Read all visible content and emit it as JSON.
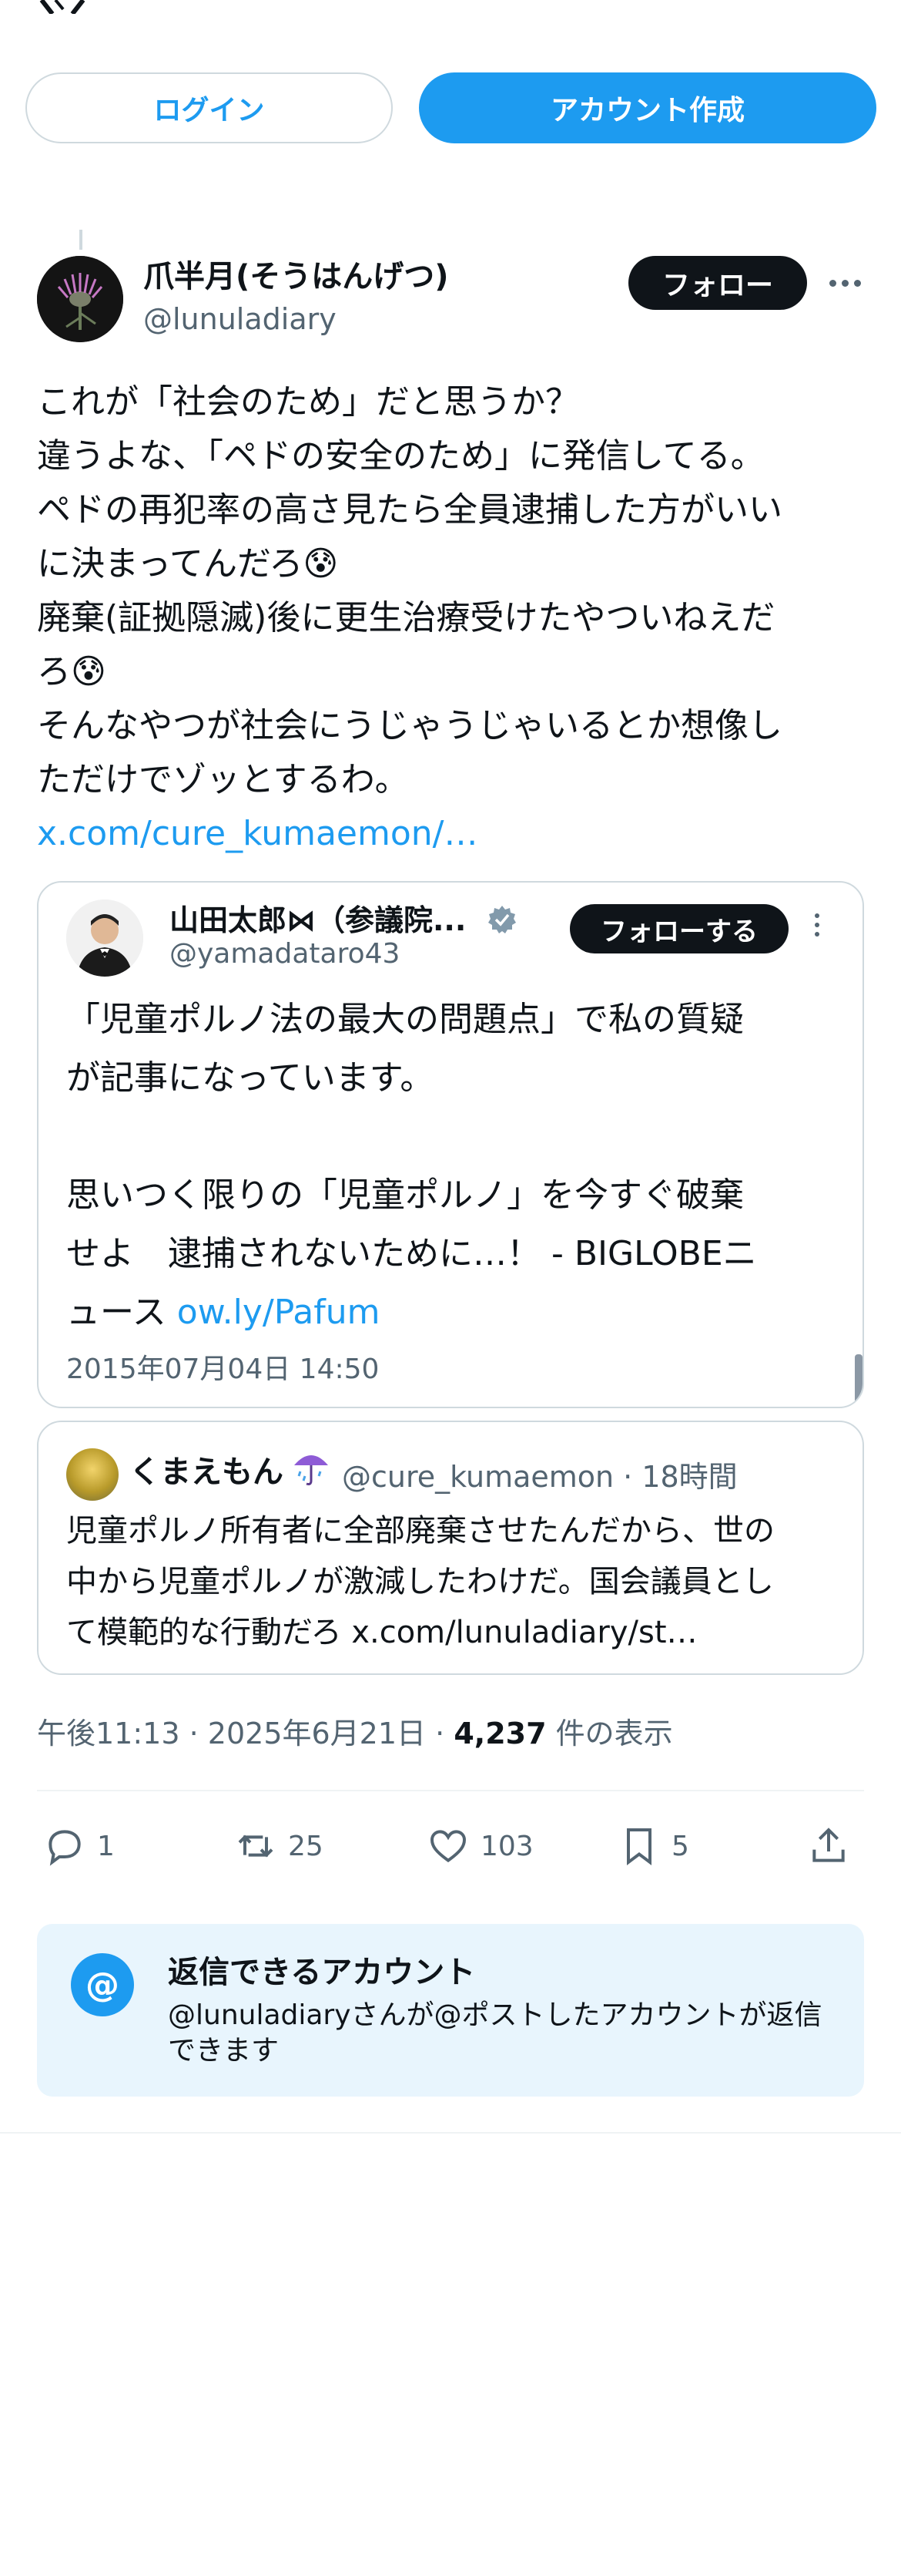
{
  "auth": {
    "login_label": "ログイン",
    "signup_label": "アカウント作成"
  },
  "post": {
    "author_name": "爪半月(そうはんげつ)",
    "author_handle": "@lunuladiary",
    "follow_label": "フォロー",
    "lines": [
      "これが「社会のため」だと思うか？",
      "違うよな、「ペドの安全のため」に発信してる。",
      "ペドの再犯率の高さ見たら全員逮捕した方がいい",
      "に決まってんだろ😰",
      "廃棄(証拠隠滅)後に更生治療受けたやついねえだ",
      "ろ😰",
      "そんなやつが社会にうじゃうじゃいるとか想像し",
      "ただけでゾッとするわ。"
    ],
    "link": "x.com/cure_kumaemon/…",
    "time": "午後11:13",
    "date": "2025年6月21日",
    "views_count": "4,237",
    "views_label": "件の表示",
    "separator": "·"
  },
  "embedded": {
    "author_name": "山田太郎⋈（参議院...",
    "author_handle": "@yamadataro43",
    "follow_label": "フォローする",
    "lines": [
      "「児童ポルノ法の最大の問題点」で私の質疑",
      "が記事になっています。",
      "思いつく限りの「児童ポルノ」を今すぐ破棄",
      "せよ　逮捕されないために…！ - BIGLOBEニ"
    ],
    "last_line_prefix": "ュース ",
    "last_line_link": "ow.ly/Pafum",
    "timestamp": "2015年07月04日 14:50"
  },
  "quoted": {
    "author_name": "くまえもん",
    "meta": "@cure_kumaemon · 18時間",
    "lines": [
      "児童ポルノ所有者に全部廃棄させたんだから、世の",
      "中から児童ポルノが激減したわけだ。国会議員とし",
      "て模範的な行動だろ x.com/lunuladiary/st…"
    ]
  },
  "actions": {
    "reply_count": "1",
    "repost_count": "25",
    "like_count": "103",
    "bookmark_count": "5"
  },
  "notice": {
    "icon": "@",
    "title": "返信できるアカウント",
    "text": "@lunuladiaryさんが@ポストしたアカウントが返信できます"
  },
  "colors": {
    "accent": "#1d9bf0",
    "text": "#0f1419",
    "muted": "#536471",
    "border": "#cfd9de",
    "notice_bg": "#e8f5fd"
  }
}
